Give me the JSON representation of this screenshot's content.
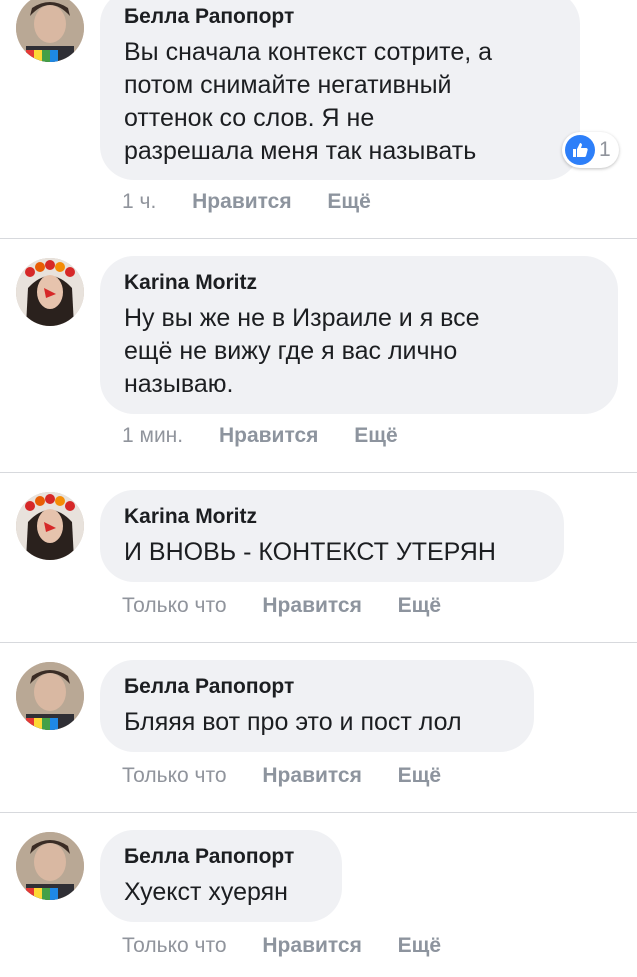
{
  "colors": {
    "bubble": "#f0f1f4",
    "like_blue": "#2d7ff9",
    "meta_gray": "#90949c"
  },
  "comments": [
    {
      "author": "Белла Рапопорт",
      "text": "Вы сначала контекст сотрите, а\nпотом снимайте негативный\nоттенок со слов. Я не\nразрешала меня так называть",
      "time": "1 ч.",
      "like_label": "Нравится",
      "more_label": "Ещё",
      "reaction_count": "1",
      "reaction_icon": "thumbs-up-icon"
    },
    {
      "author": "Karina Moritz",
      "text": "Ну вы же не в Израиле и я все\nещё не вижу где я вас лично\nназываю.",
      "time": "1 мин.",
      "like_label": "Нравится",
      "more_label": "Ещё"
    },
    {
      "author": "Karina Moritz",
      "text": "И ВНОВЬ - КОНТЕКСТ УТЕРЯН",
      "time": "Только что",
      "like_label": "Нравится",
      "more_label": "Ещё"
    },
    {
      "author": "Белла Рапопорт",
      "text": "Бляяя вот про это и пост лол",
      "time": "Только что",
      "like_label": "Нравится",
      "more_label": "Ещё"
    },
    {
      "author": "Белла Рапопорт",
      "text": "Хуекст хуерян",
      "time": "Только что",
      "like_label": "Нравится",
      "more_label": "Ещё"
    }
  ]
}
